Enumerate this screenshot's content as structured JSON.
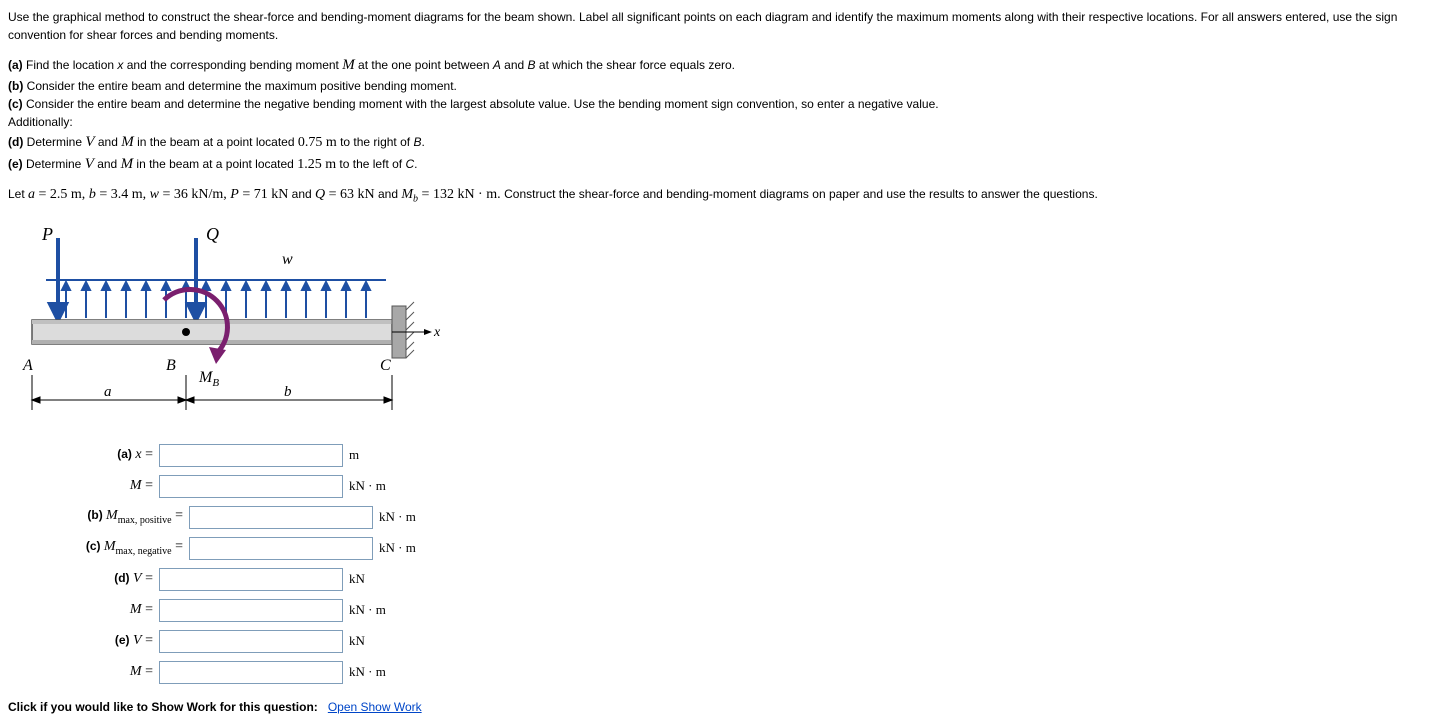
{
  "intro": "Use the graphical method to construct the shear-force and bending-moment diagrams for the beam shown. Label all significant points on each diagram and identify the maximum moments along with their respective locations. For all answers entered, use the sign convention for shear forces and bending moments.",
  "parts": {
    "a_prefix": "(a)",
    "a_text1": " Find the location ",
    "a_var": "x",
    "a_text2": " and the corresponding bending moment ",
    "a_var2": "M",
    "a_text3": " at the one point between ",
    "a_var3": "A",
    "a_text4": " and ",
    "a_var4": "B",
    "a_text5": " at which the shear force equals zero.",
    "b_prefix": "(b)",
    "b_text": " Consider the entire beam and determine the maximum positive bending moment.",
    "c_prefix": "(c)",
    "c_text": " Consider the entire beam and determine the negative bending moment with the largest absolute value.  Use the bending moment sign convention, so enter a negative value.",
    "additionally": "Additionally:",
    "d_prefix": "(d)",
    "d_text1": "  Determine ",
    "d_var1": "V",
    "d_text2": " and ",
    "d_var2": "M",
    "d_text3": " in the beam at a point located ",
    "d_val": "0.75 m",
    "d_text4": " to the right of ",
    "d_var3": "B",
    "d_text5": ".",
    "e_prefix": "(e)",
    "e_text1": "  Determine ",
    "e_var1": "V",
    "e_text2": " and ",
    "e_var2": "M",
    "e_text3": " in the beam at a point located ",
    "e_val": "1.25 m",
    "e_text4": " to the left of ",
    "e_var3": "C",
    "e_text5": "."
  },
  "let": {
    "pre": "Let ",
    "a": "a",
    "a_eq": " = 2.5 m, ",
    "b": "b",
    "b_eq": " = 3.4 m, ",
    "w": "w",
    "w_eq": " = 36 kN/m, ",
    "P": "P",
    "P_eq": " = 71 kN",
    "and1": " and ",
    "Q": "Q",
    "Q_eq": " = 63 kN",
    "and2": " and ",
    "Mb": "M",
    "Mb_sub": "b",
    "Mb_eq": " = 132 kN · m. ",
    "tail": "Construct the shear-force and bending-moment diagrams on paper and use the results to answer the questions."
  },
  "figure": {
    "P": "P",
    "Q": "Q",
    "w": "w",
    "x": "x",
    "A": "A",
    "B": "B",
    "C": "C",
    "Mb": "M",
    "Mb_sub": "B",
    "a": "a",
    "b": "b"
  },
  "inputs": {
    "a_x_label": "(a) x =",
    "a_M_label": "M =",
    "b_label_prefix": "(b) ",
    "b_label_M": "M",
    "b_label_sub": "max, positive",
    "b_label_eq": " =",
    "c_label_prefix": "(c) ",
    "c_label_M": "M",
    "c_label_sub": "max, negative",
    "c_label_eq": " =",
    "d_V_label": "(d) V =",
    "d_M_label": "M =",
    "e_V_label": "(e) V =",
    "e_M_label": "M =",
    "unit_m": "m",
    "unit_kNm": "kN · m",
    "unit_kN": "kN"
  },
  "show_work": {
    "prefix": "Click if you would like to Show Work for this question:",
    "link": "Open Show Work"
  }
}
